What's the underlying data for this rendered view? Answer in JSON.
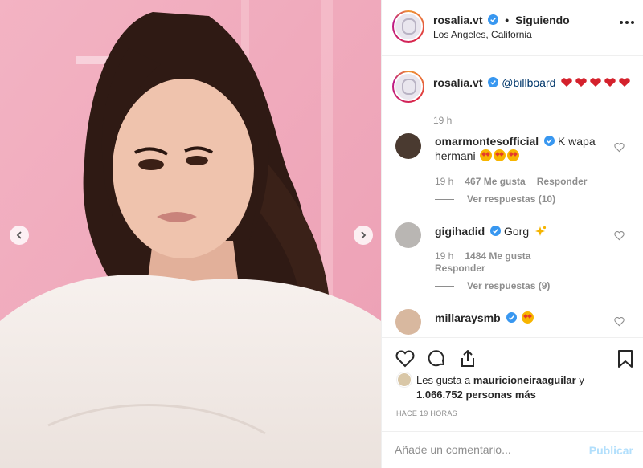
{
  "post": {
    "author": "rosalia.vt",
    "follow_status": "Siguiendo",
    "separator": "•",
    "location": "Los Angeles, California"
  },
  "caption": {
    "author": "rosalia.vt",
    "mention": "@billboard",
    "time": "19 h"
  },
  "comments": [
    {
      "user": "omarmontesofficial",
      "text": "K wapa hermani",
      "time": "19 h",
      "likes": "467 Me gusta",
      "reply": "Responder",
      "view_replies": "Ver respuestas (10)"
    },
    {
      "user": "gigihadid",
      "text": "Gorg",
      "time": "19 h",
      "likes": "1484 Me gusta",
      "reply": "Responder",
      "view_replies": "Ver respuestas (9)"
    },
    {
      "user": "millaraysmb",
      "text": ""
    }
  ],
  "likes_summary": {
    "prefix": "Les gusta a",
    "user": "mauricioneiraaguilar",
    "joiner": "y",
    "count": "1.066.752 personas más"
  },
  "timestamp": "HACE 19 HORAS",
  "comment_input": {
    "placeholder": "Añade un comentario..."
  },
  "publish_label": "Publicar",
  "icons": [
    "chevron-left-icon",
    "chevron-right-icon",
    "more-options-icon",
    "verified-badge-icon",
    "heart-icon",
    "comment-icon",
    "share-icon",
    "bookmark-icon"
  ],
  "colors": {
    "accent_blue": "#0095f6",
    "publish_disabled": "#b2dffc",
    "verified": "#3897f0",
    "mention": "#00376b",
    "muted": "#8e8e8e"
  }
}
